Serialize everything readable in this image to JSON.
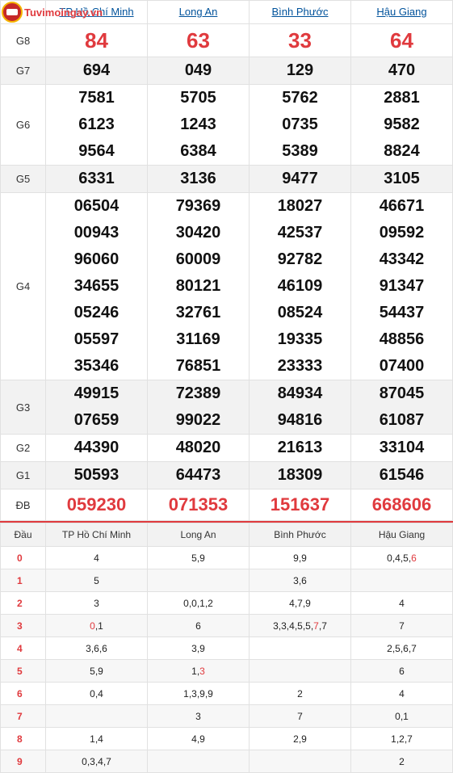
{
  "logo": {
    "text": "Tuvimoingay.vn",
    "icon": "coin-logo-icon"
  },
  "provinces": [
    "TP Hồ Chí Minh",
    "Long An",
    "Bình Phước",
    "Hậu Giang"
  ],
  "results": [
    {
      "label": "G8",
      "style": "red",
      "values": [
        [
          "84"
        ],
        [
          "63"
        ],
        [
          "33"
        ],
        [
          "64"
        ]
      ]
    },
    {
      "label": "G7",
      "style": "normal",
      "alt": true,
      "values": [
        [
          "694"
        ],
        [
          "049"
        ],
        [
          "129"
        ],
        [
          "470"
        ]
      ]
    },
    {
      "label": "G6",
      "style": "normal",
      "values": [
        [
          "7581",
          "6123",
          "9564"
        ],
        [
          "5705",
          "1243",
          "6384"
        ],
        [
          "5762",
          "0735",
          "5389"
        ],
        [
          "2881",
          "9582",
          "8824"
        ]
      ]
    },
    {
      "label": "G5",
      "style": "normal",
      "alt": true,
      "values": [
        [
          "6331"
        ],
        [
          "3136"
        ],
        [
          "9477"
        ],
        [
          "3105"
        ]
      ]
    },
    {
      "label": "G4",
      "style": "normal",
      "values": [
        [
          "06504",
          "00943",
          "96060",
          "34655",
          "05246",
          "05597",
          "35346"
        ],
        [
          "79369",
          "30420",
          "60009",
          "80121",
          "32761",
          "31169",
          "76851"
        ],
        [
          "18027",
          "42537",
          "92782",
          "46109",
          "08524",
          "19335",
          "23333"
        ],
        [
          "46671",
          "09592",
          "43342",
          "91347",
          "54437",
          "48856",
          "07400"
        ]
      ]
    },
    {
      "label": "G3",
      "style": "normal",
      "alt": true,
      "values": [
        [
          "49915",
          "07659"
        ],
        [
          "72389",
          "99022"
        ],
        [
          "84934",
          "94816"
        ],
        [
          "87045",
          "61087"
        ]
      ]
    },
    {
      "label": "G2",
      "style": "normal",
      "values": [
        [
          "44390"
        ],
        [
          "48020"
        ],
        [
          "21613"
        ],
        [
          "33104"
        ]
      ]
    },
    {
      "label": "G1",
      "style": "normal",
      "alt": true,
      "values": [
        [
          "50593"
        ],
        [
          "64473"
        ],
        [
          "18309"
        ],
        [
          "61546"
        ]
      ]
    },
    {
      "label": "ĐB",
      "style": "db",
      "values": [
        [
          "059230"
        ],
        [
          "071353"
        ],
        [
          "151637"
        ],
        [
          "668606"
        ]
      ]
    }
  ],
  "loto": {
    "header": [
      "Đầu",
      "TP Hồ Chí Minh",
      "Long An",
      "Bình Phước",
      "Hậu Giang"
    ],
    "rows": [
      {
        "head": "0",
        "cells": [
          [
            {
              "t": "4"
            }
          ],
          [
            {
              "t": "5,9"
            }
          ],
          [
            {
              "t": "9,9"
            }
          ],
          [
            {
              "t": "0,4,5,"
            },
            {
              "t": "6",
              "red": true
            }
          ]
        ]
      },
      {
        "head": "1",
        "cells": [
          [
            {
              "t": "5"
            }
          ],
          [],
          [
            {
              "t": "3,6"
            }
          ],
          []
        ]
      },
      {
        "head": "2",
        "cells": [
          [
            {
              "t": "3"
            }
          ],
          [
            {
              "t": "0,0,1,2"
            }
          ],
          [
            {
              "t": "4,7,9"
            }
          ],
          [
            {
              "t": "4"
            }
          ]
        ]
      },
      {
        "head": "3",
        "cells": [
          [
            {
              "t": "0",
              "red": true
            },
            {
              "t": ",1"
            }
          ],
          [
            {
              "t": "6"
            }
          ],
          [
            {
              "t": "3,3,4,5,5,"
            },
            {
              "t": "7",
              "red": true
            },
            {
              "t": ",7"
            }
          ],
          [
            {
              "t": "7"
            }
          ]
        ]
      },
      {
        "head": "4",
        "cells": [
          [
            {
              "t": "3,6,6"
            }
          ],
          [
            {
              "t": "3,9"
            }
          ],
          [],
          [
            {
              "t": "2,5,6,7"
            }
          ]
        ]
      },
      {
        "head": "5",
        "cells": [
          [
            {
              "t": "5,9"
            }
          ],
          [
            {
              "t": "1,"
            },
            {
              "t": "3",
              "red": true
            }
          ],
          [],
          [
            {
              "t": "6"
            }
          ]
        ]
      },
      {
        "head": "6",
        "cells": [
          [
            {
              "t": "0,4"
            }
          ],
          [
            {
              "t": "1,3,9,9"
            }
          ],
          [
            {
              "t": "2"
            }
          ],
          [
            {
              "t": "4"
            }
          ]
        ]
      },
      {
        "head": "7",
        "cells": [
          [],
          [
            {
              "t": "3"
            }
          ],
          [
            {
              "t": "7"
            }
          ],
          [
            {
              "t": "0,1"
            }
          ]
        ]
      },
      {
        "head": "8",
        "cells": [
          [
            {
              "t": "1,4"
            }
          ],
          [
            {
              "t": "4,9"
            }
          ],
          [
            {
              "t": "2,9"
            }
          ],
          [
            {
              "t": "1,2,7"
            }
          ]
        ]
      },
      {
        "head": "9",
        "cells": [
          [
            {
              "t": "0,3,4,7"
            }
          ],
          [],
          [],
          [
            {
              "t": "2"
            }
          ]
        ]
      }
    ]
  },
  "colors": {
    "accent": "#e03a3e",
    "link": "#00529b",
    "alt_row": "#f2f2f2"
  }
}
